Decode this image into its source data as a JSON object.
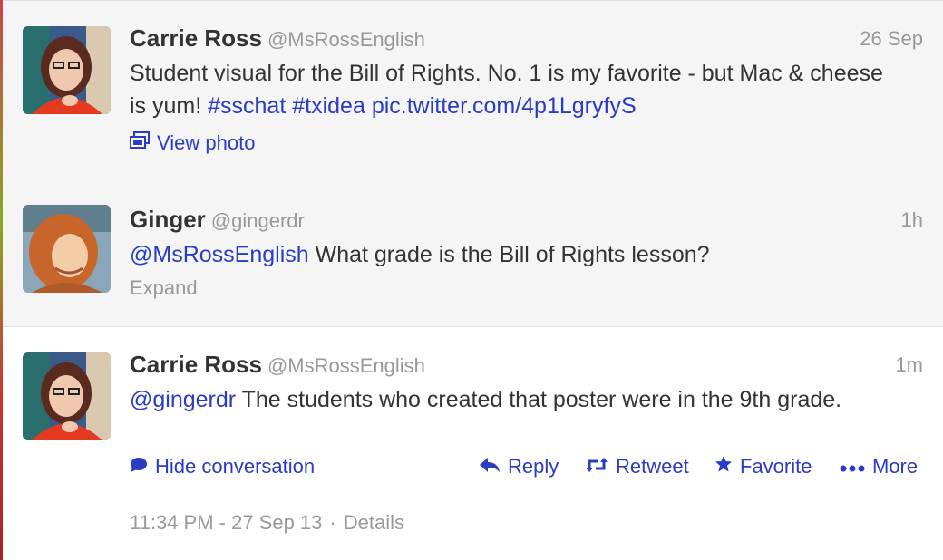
{
  "tweets": [
    {
      "name": "Carrie Ross",
      "handle": "@MsRossEnglish",
      "time": "26 Sep",
      "text_1": "Student visual for the Bill of Rights. No. 1 is my favorite - but Mac & cheese is yum! ",
      "hashtag_1": "#sschat",
      "hashtag_2": "#txidea",
      "pic_link": "pic.twitter.com/4p1LgryfyS",
      "view_photo": "View photo"
    },
    {
      "name": "Ginger",
      "handle": "@gingerdr",
      "time": "1h",
      "mention": "@MsRossEnglish",
      "text": " What grade is the Bill of Rights lesson?",
      "expand": "Expand"
    },
    {
      "name": "Carrie Ross",
      "handle": "@MsRossEnglish",
      "time": "1m",
      "mention": "@gingerdr",
      "text": " The students who created that poster were in the 9th grade.",
      "hide_conversation": "Hide conversation",
      "reply": "Reply",
      "retweet": "Retweet",
      "favorite": "Favorite",
      "more": "More",
      "timestamp": "11:34 PM - 27 Sep 13",
      "separator": "·",
      "details": "Details"
    }
  ],
  "icons": {
    "photo": "photo-icon",
    "reply": "reply-icon",
    "retweet": "retweet-icon",
    "favorite": "star-icon",
    "more": "ellipsis-icon",
    "conversation": "speech-bubble-icon"
  },
  "colors": {
    "link": "#2a3bc4",
    "muted": "#999999",
    "text": "#333333"
  }
}
